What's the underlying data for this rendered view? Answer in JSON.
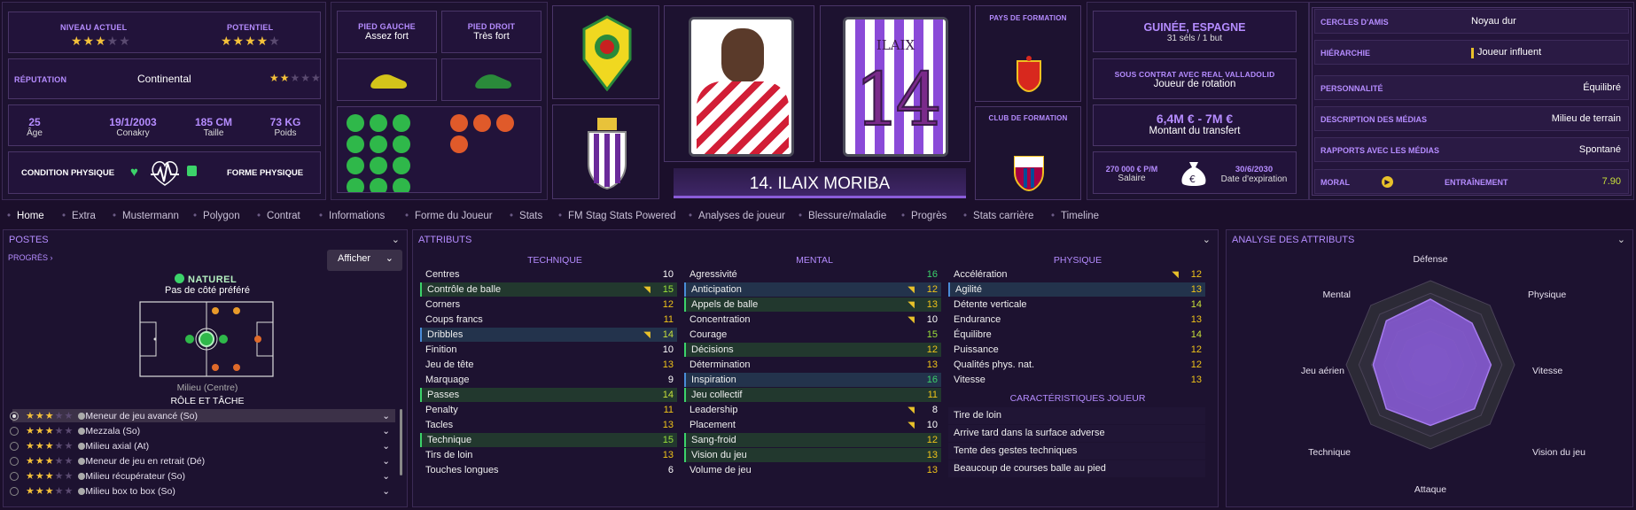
{
  "ratings": {
    "current_label": "NIVEAU ACTUEL",
    "current_stars": 3,
    "potential_label": "POTENTIEL",
    "potential_stars": 4
  },
  "reputation": {
    "label": "RÉPUTATION",
    "value": "Continental",
    "stars": 2
  },
  "bio": {
    "age": "25",
    "age_label": "Âge",
    "dob": "19/1/2003",
    "birthplace": "Conakry",
    "height": "185 CM",
    "height_label": "Taille",
    "weight": "73 KG",
    "weight_label": "Poids"
  },
  "condition": {
    "label": "CONDITION PHYSIQUE",
    "form_label": "FORME PHYSIQUE"
  },
  "feet": {
    "left_label": "PIED GAUCHE",
    "left_value": "Assez fort",
    "right_label": "PIED DROIT",
    "right_value": "Très fort"
  },
  "player": {
    "number": "14",
    "shirt_name": "ILAIX",
    "display_name": "14. ILAIX MORIBA"
  },
  "training": {
    "nation_label": "PAYS DE FORMATION",
    "club_label": "CLUB DE FORMATION"
  },
  "international": {
    "country": "GUINÉE, ESPAGNE",
    "caps": "31 séls / 1 but"
  },
  "contract": {
    "label": "SOUS CONTRAT AVEC REAL VALLADOLID",
    "role": "Joueur de rotation",
    "value": "6,4M € - 7M €",
    "value_label": "Montant du transfert",
    "salary": "270 000 € P/M",
    "salary_label": "Salaire",
    "expiry": "30/6/2030",
    "expiry_label": "Date d'expiration"
  },
  "info": [
    {
      "key": "CERCLES D'AMIS",
      "value": "Noyau dur"
    },
    {
      "key": "HIÉRARCHIE",
      "value": "Joueur influent"
    },
    {
      "key": "PERSONNALITÉ",
      "value": "Équilibré"
    },
    {
      "key": "DESCRIPTION DES MÉDIAS",
      "value": "Milieu de terrain"
    },
    {
      "key": "RAPPORTS AVEC LES MÉDIAS",
      "value": "Spontané"
    }
  ],
  "morale": {
    "label": "MORAL",
    "training_label": "ENTRAÎNEMENT",
    "training_value": "7.90"
  },
  "tabs": [
    "Home",
    "Extra",
    "Mustermann",
    "Polygon",
    "Contrat",
    "Informations",
    "Forme du Joueur",
    "Stats",
    "FM Stag Stats Powered",
    "Analyses de joueur",
    "Blessure/maladie",
    "Progrès",
    "Stats carrière",
    "Timeline"
  ],
  "positions": {
    "title": "POSTES",
    "progress_link": "PROGRÈS",
    "show_button": "Afficher",
    "natural_label": "NATUREL",
    "foot_note": "Pas de côté préféré",
    "position_name": "Milieu (Centre)",
    "role_title": "RÔLE ET TÂCHE"
  },
  "roles": [
    {
      "name": "Meneur de jeu avancé (So)",
      "stars": 3
    },
    {
      "name": "Mezzala (So)",
      "stars": 3
    },
    {
      "name": "Milieu axial (At)",
      "stars": 3
    },
    {
      "name": "Meneur de jeu en retrait (Dé)",
      "stars": 3
    },
    {
      "name": "Milieu récupérateur (So)",
      "stars": 3
    },
    {
      "name": "Milieu box to box (So)",
      "stars": 3
    }
  ],
  "attributes": {
    "title": "ATTRIBUTS",
    "technical_label": "TECHNIQUE",
    "mental_label": "MENTAL",
    "physical_label": "PHYSIQUE",
    "traits_label": "CARACTÉRISTIQUES JOUEUR",
    "technical": [
      {
        "name": "Centres",
        "value": "10",
        "hl": ""
      },
      {
        "name": "Contrôle de balle",
        "value": "15",
        "hl": "g",
        "arrow": true
      },
      {
        "name": "Corners",
        "value": "12",
        "hl": ""
      },
      {
        "name": "Coups francs",
        "value": "11",
        "hl": ""
      },
      {
        "name": "Dribbles",
        "value": "14",
        "hl": "b",
        "arrow": true
      },
      {
        "name": "Finition",
        "value": "10",
        "hl": ""
      },
      {
        "name": "Jeu de tête",
        "value": "13",
        "hl": ""
      },
      {
        "name": "Marquage",
        "value": "9",
        "hl": ""
      },
      {
        "name": "Passes",
        "value": "14",
        "hl": "g"
      },
      {
        "name": "Penalty",
        "value": "11",
        "hl": ""
      },
      {
        "name": "Tacles",
        "value": "13",
        "hl": ""
      },
      {
        "name": "Technique",
        "value": "15",
        "hl": "g"
      },
      {
        "name": "Tirs de loin",
        "value": "13",
        "hl": ""
      },
      {
        "name": "Touches longues",
        "value": "6",
        "hl": ""
      }
    ],
    "mental": [
      {
        "name": "Agressivité",
        "value": "16",
        "hl": ""
      },
      {
        "name": "Anticipation",
        "value": "12",
        "hl": "b",
        "arrow": true
      },
      {
        "name": "Appels de balle",
        "value": "13",
        "hl": "g",
        "arrow": true
      },
      {
        "name": "Concentration",
        "value": "10",
        "hl": "",
        "arrow": true
      },
      {
        "name": "Courage",
        "value": "15",
        "hl": ""
      },
      {
        "name": "Décisions",
        "value": "12",
        "hl": "g"
      },
      {
        "name": "Détermination",
        "value": "13",
        "hl": ""
      },
      {
        "name": "Inspiration",
        "value": "16",
        "hl": "b"
      },
      {
        "name": "Jeu collectif",
        "value": "11",
        "hl": "g"
      },
      {
        "name": "Leadership",
        "value": "8",
        "hl": "",
        "arrow": true
      },
      {
        "name": "Placement",
        "value": "10",
        "hl": "",
        "arrow": true
      },
      {
        "name": "Sang-froid",
        "value": "12",
        "hl": "g"
      },
      {
        "name": "Vision du jeu",
        "value": "13",
        "hl": "g"
      },
      {
        "name": "Volume de jeu",
        "value": "13",
        "hl": ""
      }
    ],
    "physical": [
      {
        "name": "Accélération",
        "value": "12",
        "hl": "",
        "arrow": true
      },
      {
        "name": "Agilité",
        "value": "13",
        "hl": "b"
      },
      {
        "name": "Détente verticale",
        "value": "14",
        "hl": ""
      },
      {
        "name": "Endurance",
        "value": "13",
        "hl": ""
      },
      {
        "name": "Équilibre",
        "value": "14",
        "hl": ""
      },
      {
        "name": "Puissance",
        "value": "12",
        "hl": ""
      },
      {
        "name": "Qualités phys. nat.",
        "value": "12",
        "hl": ""
      },
      {
        "name": "Vitesse",
        "value": "13",
        "hl": ""
      }
    ],
    "traits": [
      "Tire de loin",
      "Arrive tard dans la surface adverse",
      "Tente des gestes techniques",
      "Beaucoup de courses balle au pied"
    ]
  },
  "analysis": {
    "title": "ANALYSE DES ATTRIBUTS",
    "labels": [
      "Défense",
      "Physique",
      "Vitesse",
      "Vision du jeu",
      "Attaque",
      "Technique",
      "Jeu aérien",
      "Mental"
    ]
  },
  "colors": {
    "bg": "#1b0f2b",
    "accent": "#b58cff",
    "star": "#f4c13a",
    "good": "#3cd36a"
  }
}
